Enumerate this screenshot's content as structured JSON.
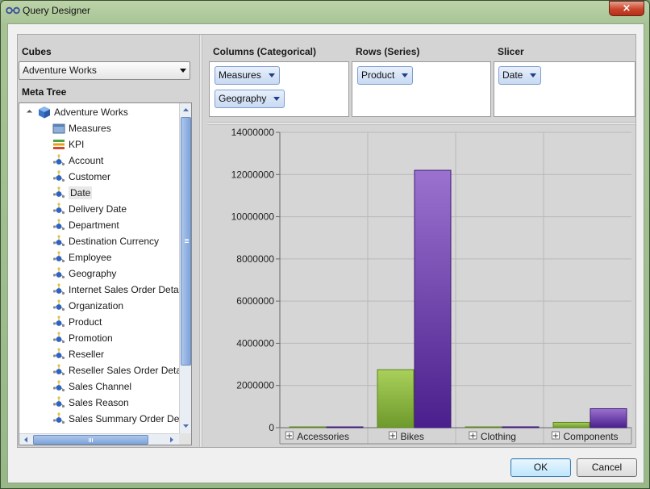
{
  "window": {
    "title": "Query Designer",
    "close_label": "×"
  },
  "cubes": {
    "label": "Cubes",
    "selected": "Adventure Works"
  },
  "meta_tree": {
    "label": "Meta Tree",
    "root": {
      "label": "Adventure Works",
      "icon": "cube-icon"
    },
    "items": [
      {
        "label": "Measures",
        "icon": "measures-icon"
      },
      {
        "label": "KPI",
        "icon": "kpi-icon"
      },
      {
        "label": "Account",
        "icon": "dimension-icon"
      },
      {
        "label": "Customer",
        "icon": "dimension-icon"
      },
      {
        "label": "Date",
        "icon": "dimension-icon"
      },
      {
        "label": "Delivery Date",
        "icon": "dimension-icon"
      },
      {
        "label": "Department",
        "icon": "dimension-icon"
      },
      {
        "label": "Destination Currency",
        "icon": "dimension-icon"
      },
      {
        "label": "Employee",
        "icon": "dimension-icon"
      },
      {
        "label": "Geography",
        "icon": "dimension-icon"
      },
      {
        "label": "Internet Sales Order Deta",
        "icon": "dimension-icon"
      },
      {
        "label": "Organization",
        "icon": "dimension-icon"
      },
      {
        "label": "Product",
        "icon": "dimension-icon"
      },
      {
        "label": "Promotion",
        "icon": "dimension-icon"
      },
      {
        "label": "Reseller",
        "icon": "dimension-icon"
      },
      {
        "label": "Reseller Sales Order Deta",
        "icon": "dimension-icon"
      },
      {
        "label": "Sales Channel",
        "icon": "dimension-icon"
      },
      {
        "label": "Sales Reason",
        "icon": "dimension-icon"
      },
      {
        "label": "Sales Summary Order De",
        "icon": "dimension-icon"
      }
    ]
  },
  "columns": {
    "label": "Columns (Categorical)",
    "chips": [
      "Measures",
      "Geography"
    ]
  },
  "rows": {
    "label": "Rows (Series)",
    "chips": [
      "Product"
    ]
  },
  "slicer": {
    "label": "Slicer",
    "chips": [
      "Date"
    ]
  },
  "chart_data": {
    "type": "bar",
    "categories": [
      "Accessories",
      "Bikes",
      "Clothing",
      "Components"
    ],
    "series": [
      {
        "values": [
          0,
          2750000,
          0,
          250000
        ]
      },
      {
        "values": [
          30000,
          12200000,
          40000,
          900000
        ]
      }
    ],
    "ylim": [
      0,
      14000000
    ],
    "yticks": [
      "0",
      "2000000",
      "4000000",
      "6000000",
      "8000000",
      "10000000",
      "12000000",
      "14000000"
    ],
    "category_expand_glyph": "+",
    "grid": true,
    "colors": {
      "series1": "#8ab43e",
      "series2": "#6a3aa5",
      "plot_bg": "#d6d6d6"
    }
  },
  "buttons": {
    "ok": "OK",
    "cancel": "Cancel"
  }
}
